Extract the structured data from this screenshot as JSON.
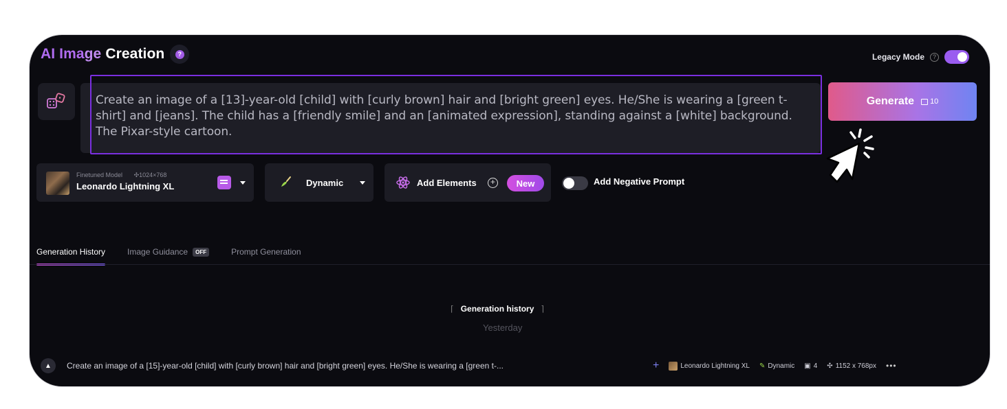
{
  "header": {
    "title_part1": "AI Ima",
    "title_part2": "ge",
    "title_part3": "Creation",
    "help_badge": "?",
    "legacy_label": "Legacy Mode",
    "legacy_help": "?",
    "legacy_on": true
  },
  "prompt": {
    "text": "Create an image of a [13]-year-old [child] with [curly brown] hair and [bright green] eyes. He/She is wearing a [green t-shirt] and [jeans]. The child has a [friendly smile] and an [animated expression], standing against a [white] background. The Pixar-style cartoon."
  },
  "generate": {
    "label": "Generate",
    "cost": "10"
  },
  "model": {
    "sub_label": "Finetuned Model",
    "dimensions": "1024×768",
    "name": "Leonardo Lightning XL"
  },
  "style": {
    "label": "Dynamic"
  },
  "elements": {
    "label": "Add Elements",
    "badge": "New"
  },
  "negative_prompt": {
    "label": "Add Negative Prompt",
    "enabled": false
  },
  "tabs": [
    {
      "label": "Generation History",
      "active": true
    },
    {
      "label": "Image Guidance",
      "badge": "OFF",
      "active": false
    },
    {
      "label": "Prompt Generation",
      "active": false
    }
  ],
  "history": {
    "title": "Generation history",
    "group": "Yesterday",
    "item": {
      "prompt": "Create an image of a [15]-year-old [child] with [curly brown] hair and [bright green] eyes. He/She is wearing a [green t-...",
      "model": "Leonardo Lightning XL",
      "style": "Dynamic",
      "count": "4",
      "size": "1152 x 768px"
    }
  },
  "colors": {
    "accent_purple": "#9a5cf0",
    "highlight_border": "#7a2fe0",
    "generate_gradient_start": "#e05a8a",
    "generate_gradient_end": "#6f84f2"
  }
}
